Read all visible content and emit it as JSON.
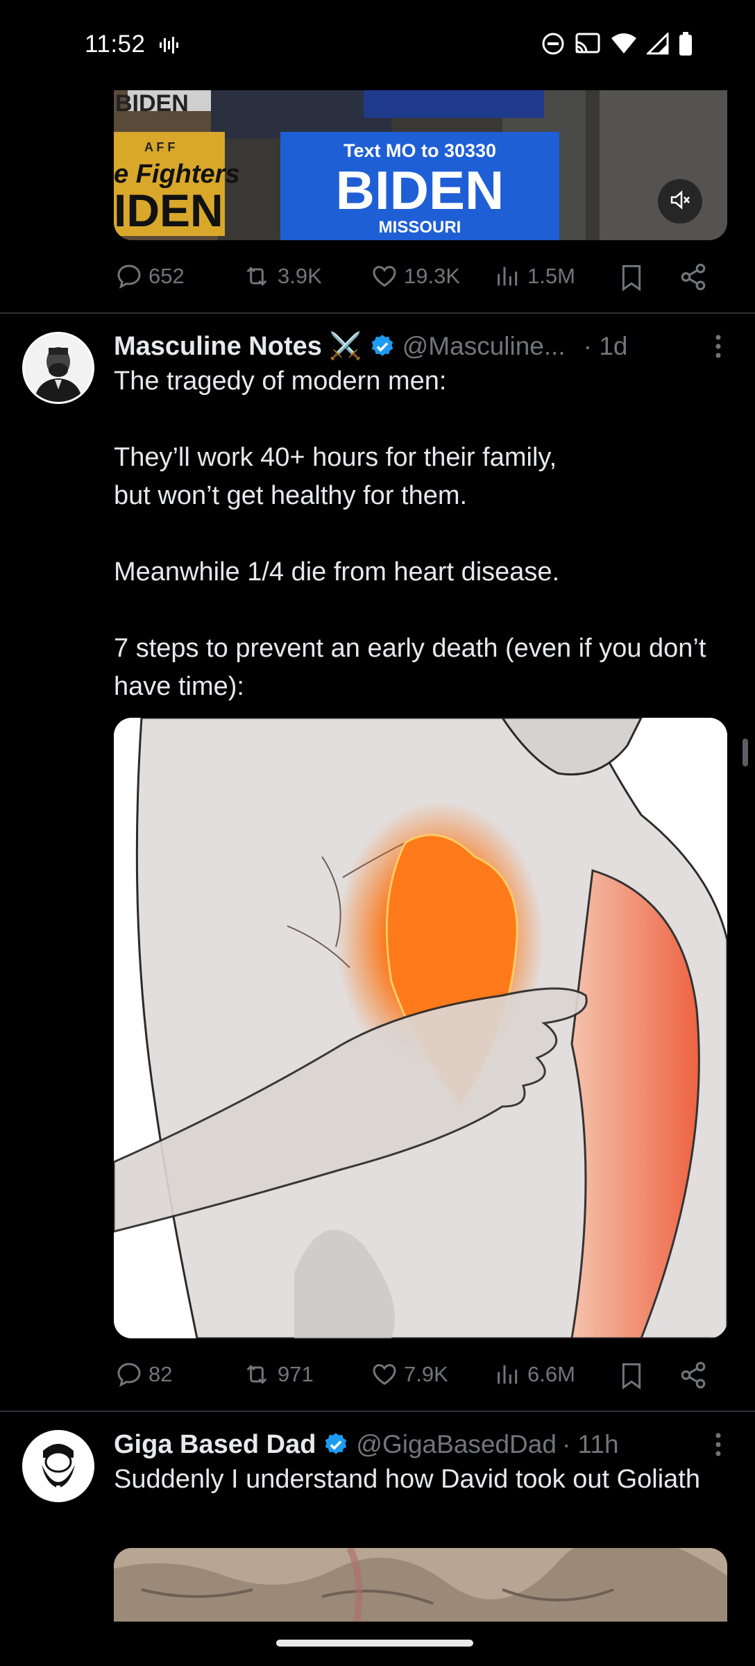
{
  "status_bar": {
    "time": "11:52",
    "icons": [
      "voice-recording-icon",
      "do-not-disturb-icon",
      "cast-icon",
      "wifi-icon",
      "signal-icon",
      "battery-icon"
    ]
  },
  "video_post": {
    "media": {
      "sign_line1": "Text MO to 30330",
      "sign_line2": "BIDEN",
      "sign_line3": "MISSOURI",
      "left_sign_line1": "e Fighters",
      "left_sign_line2": "IDEN",
      "left_sign_top": "A F F"
    },
    "stats": {
      "replies": "652",
      "reposts": "3.9K",
      "likes": "19.3K",
      "views": "1.5M"
    }
  },
  "tweet1": {
    "author_name": "Masculine Notes ⚔️",
    "handle": "@Masculine...",
    "time": "· 1d",
    "text": "The tragedy of modern men:\n\nThey’ll work 40+ hours for their family,\nbut won’t get healthy for them.\n\nMeanwhile 1/4 die from heart disease.\n\n7 steps to prevent an early death (even if you don’t have time):",
    "stats": {
      "replies": "82",
      "reposts": "971",
      "likes": "7.9K",
      "views": "6.6M"
    }
  },
  "tweet2": {
    "author_name": "Giga Based Dad",
    "handle": "@GigaBasedDad",
    "time": "· 11h",
    "text": "Suddenly I understand how David took out Goliath"
  },
  "colors": {
    "background": "#000000",
    "text": "#e7e9ea",
    "muted": "#71767b",
    "verified": "#1d9bf0",
    "divider": "#2f3336"
  }
}
